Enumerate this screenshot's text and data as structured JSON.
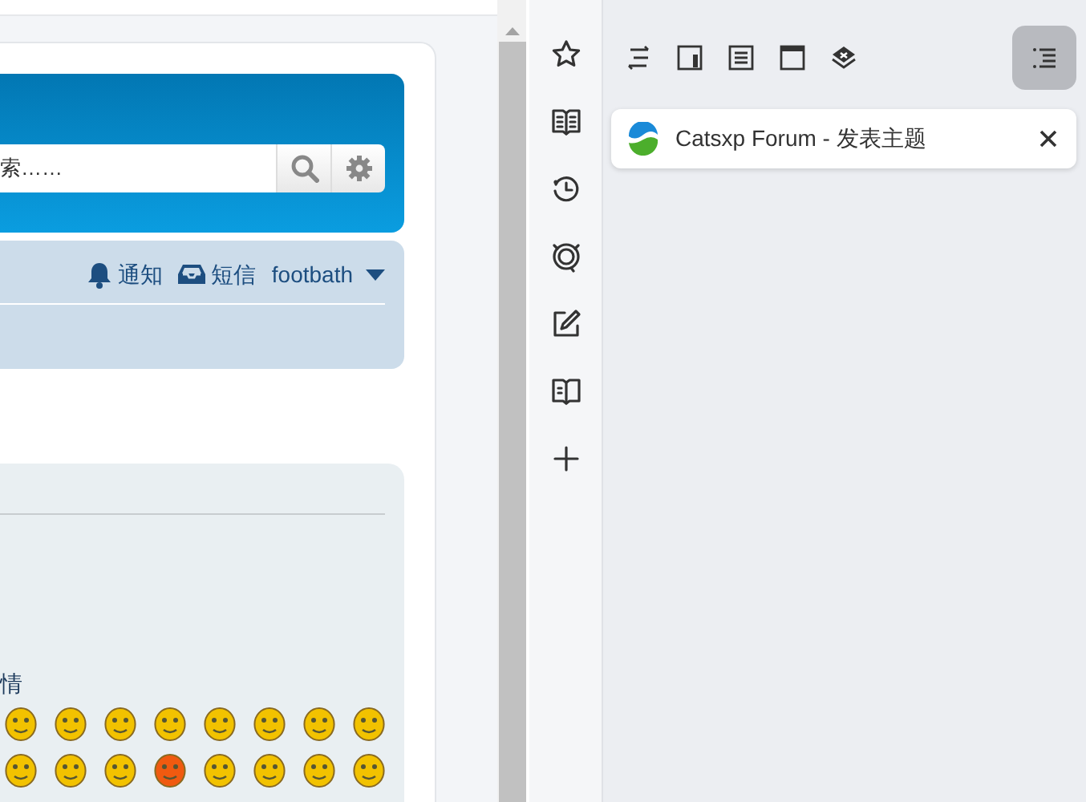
{
  "page": {
    "search": {
      "value": "索……"
    },
    "user_nav": [
      {
        "kind": "notifications",
        "label": "通知"
      },
      {
        "kind": "messages",
        "label": "短信"
      },
      {
        "kind": "user",
        "label": "footbath"
      }
    ],
    "emoticons": {
      "heading": "情",
      "rows": [
        [
          {
            "color": "#f2c200"
          },
          {
            "color": "#f2c200"
          },
          {
            "color": "#f2c200"
          },
          {
            "color": "#f2c200"
          },
          {
            "color": "#f2c200"
          },
          {
            "color": "#f2c200"
          },
          {
            "color": "#f2c200"
          },
          {
            "color": "#f2c200"
          }
        ],
        [
          {
            "color": "#f2c200"
          },
          {
            "color": "#f2c200"
          },
          {
            "color": "#f2c200"
          },
          {
            "color": "#f05a10"
          },
          {
            "color": "#f2c200"
          },
          {
            "color": "#f2c200"
          },
          {
            "color": "#f2c200"
          },
          {
            "color": "#f2c200"
          }
        ]
      ]
    }
  },
  "sidebar": {
    "rail": [
      {
        "kind": "star"
      },
      {
        "kind": "book"
      },
      {
        "kind": "history"
      },
      {
        "kind": "lens"
      },
      {
        "kind": "edit"
      },
      {
        "kind": "reader"
      },
      {
        "kind": "plus"
      }
    ],
    "toolbar": [
      {
        "kind": "swap",
        "selected": false
      },
      {
        "kind": "panel",
        "selected": false
      },
      {
        "kind": "list",
        "selected": false
      },
      {
        "kind": "window",
        "selected": false
      },
      {
        "kind": "layers",
        "selected": false
      },
      {
        "kind": "outline",
        "selected": true
      }
    ],
    "tabs": [
      {
        "title": "Catsxp Forum - 发表主题"
      }
    ]
  }
}
